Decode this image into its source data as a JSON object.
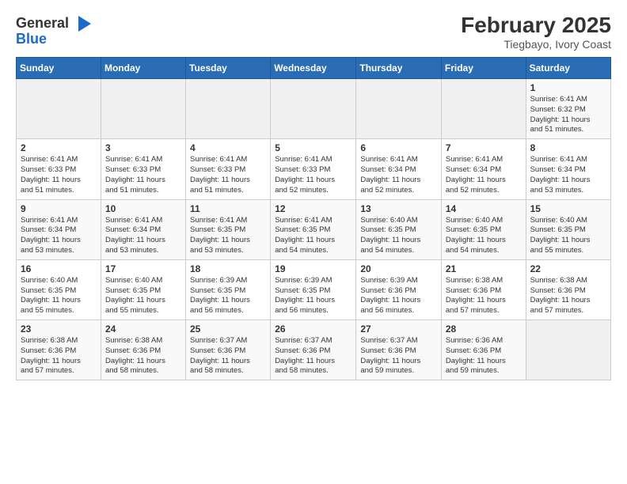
{
  "header": {
    "logo_general": "General",
    "logo_blue": "Blue",
    "month_title": "February 2025",
    "subtitle": "Tiegbayo, Ivory Coast"
  },
  "weekdays": [
    "Sunday",
    "Monday",
    "Tuesday",
    "Wednesday",
    "Thursday",
    "Friday",
    "Saturday"
  ],
  "weeks": [
    [
      {
        "day": "",
        "info": ""
      },
      {
        "day": "",
        "info": ""
      },
      {
        "day": "",
        "info": ""
      },
      {
        "day": "",
        "info": ""
      },
      {
        "day": "",
        "info": ""
      },
      {
        "day": "",
        "info": ""
      },
      {
        "day": "1",
        "info": "Sunrise: 6:41 AM\nSunset: 6:32 PM\nDaylight: 11 hours\nand 51 minutes."
      }
    ],
    [
      {
        "day": "2",
        "info": "Sunrise: 6:41 AM\nSunset: 6:33 PM\nDaylight: 11 hours\nand 51 minutes."
      },
      {
        "day": "3",
        "info": "Sunrise: 6:41 AM\nSunset: 6:33 PM\nDaylight: 11 hours\nand 51 minutes."
      },
      {
        "day": "4",
        "info": "Sunrise: 6:41 AM\nSunset: 6:33 PM\nDaylight: 11 hours\nand 51 minutes."
      },
      {
        "day": "5",
        "info": "Sunrise: 6:41 AM\nSunset: 6:33 PM\nDaylight: 11 hours\nand 52 minutes."
      },
      {
        "day": "6",
        "info": "Sunrise: 6:41 AM\nSunset: 6:34 PM\nDaylight: 11 hours\nand 52 minutes."
      },
      {
        "day": "7",
        "info": "Sunrise: 6:41 AM\nSunset: 6:34 PM\nDaylight: 11 hours\nand 52 minutes."
      },
      {
        "day": "8",
        "info": "Sunrise: 6:41 AM\nSunset: 6:34 PM\nDaylight: 11 hours\nand 53 minutes."
      }
    ],
    [
      {
        "day": "9",
        "info": "Sunrise: 6:41 AM\nSunset: 6:34 PM\nDaylight: 11 hours\nand 53 minutes."
      },
      {
        "day": "10",
        "info": "Sunrise: 6:41 AM\nSunset: 6:34 PM\nDaylight: 11 hours\nand 53 minutes."
      },
      {
        "day": "11",
        "info": "Sunrise: 6:41 AM\nSunset: 6:35 PM\nDaylight: 11 hours\nand 53 minutes."
      },
      {
        "day": "12",
        "info": "Sunrise: 6:41 AM\nSunset: 6:35 PM\nDaylight: 11 hours\nand 54 minutes."
      },
      {
        "day": "13",
        "info": "Sunrise: 6:40 AM\nSunset: 6:35 PM\nDaylight: 11 hours\nand 54 minutes."
      },
      {
        "day": "14",
        "info": "Sunrise: 6:40 AM\nSunset: 6:35 PM\nDaylight: 11 hours\nand 54 minutes."
      },
      {
        "day": "15",
        "info": "Sunrise: 6:40 AM\nSunset: 6:35 PM\nDaylight: 11 hours\nand 55 minutes."
      }
    ],
    [
      {
        "day": "16",
        "info": "Sunrise: 6:40 AM\nSunset: 6:35 PM\nDaylight: 11 hours\nand 55 minutes."
      },
      {
        "day": "17",
        "info": "Sunrise: 6:40 AM\nSunset: 6:35 PM\nDaylight: 11 hours\nand 55 minutes."
      },
      {
        "day": "18",
        "info": "Sunrise: 6:39 AM\nSunset: 6:35 PM\nDaylight: 11 hours\nand 56 minutes."
      },
      {
        "day": "19",
        "info": "Sunrise: 6:39 AM\nSunset: 6:35 PM\nDaylight: 11 hours\nand 56 minutes."
      },
      {
        "day": "20",
        "info": "Sunrise: 6:39 AM\nSunset: 6:36 PM\nDaylight: 11 hours\nand 56 minutes."
      },
      {
        "day": "21",
        "info": "Sunrise: 6:38 AM\nSunset: 6:36 PM\nDaylight: 11 hours\nand 57 minutes."
      },
      {
        "day": "22",
        "info": "Sunrise: 6:38 AM\nSunset: 6:36 PM\nDaylight: 11 hours\nand 57 minutes."
      }
    ],
    [
      {
        "day": "23",
        "info": "Sunrise: 6:38 AM\nSunset: 6:36 PM\nDaylight: 11 hours\nand 57 minutes."
      },
      {
        "day": "24",
        "info": "Sunrise: 6:38 AM\nSunset: 6:36 PM\nDaylight: 11 hours\nand 58 minutes."
      },
      {
        "day": "25",
        "info": "Sunrise: 6:37 AM\nSunset: 6:36 PM\nDaylight: 11 hours\nand 58 minutes."
      },
      {
        "day": "26",
        "info": "Sunrise: 6:37 AM\nSunset: 6:36 PM\nDaylight: 11 hours\nand 58 minutes."
      },
      {
        "day": "27",
        "info": "Sunrise: 6:37 AM\nSunset: 6:36 PM\nDaylight: 11 hours\nand 59 minutes."
      },
      {
        "day": "28",
        "info": "Sunrise: 6:36 AM\nSunset: 6:36 PM\nDaylight: 11 hours\nand 59 minutes."
      },
      {
        "day": "",
        "info": ""
      }
    ]
  ]
}
